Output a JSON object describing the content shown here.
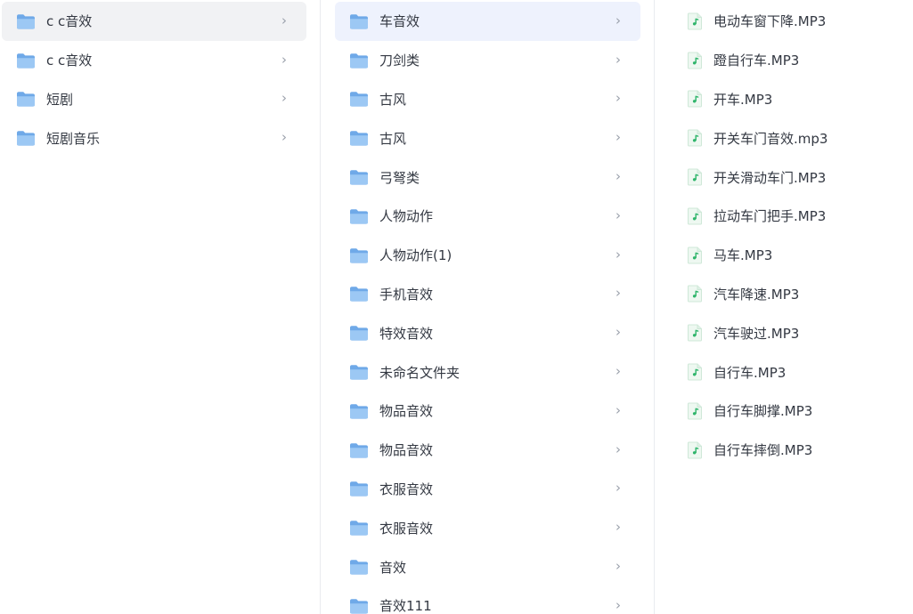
{
  "colors": {
    "folder_light": "#9cc8f4",
    "folder_dark": "#6fa9e8",
    "audio_green": "#2fb56b",
    "selected_col1": "#f1f2f4",
    "selected_col2": "#eef2fd"
  },
  "chevron_glyph": "›",
  "column1": {
    "items": [
      {
        "label": "c c音效",
        "icon": "folder-icon",
        "selected": true
      },
      {
        "label": "c c音效",
        "icon": "folder-icon",
        "selected": false
      },
      {
        "label": "短剧",
        "icon": "folder-icon",
        "selected": false
      },
      {
        "label": "短剧音乐",
        "icon": "folder-icon",
        "selected": false
      }
    ]
  },
  "column2": {
    "items": [
      {
        "label": "车音效",
        "icon": "folder-icon",
        "selected": true
      },
      {
        "label": "刀剑类",
        "icon": "folder-icon",
        "selected": false
      },
      {
        "label": "古风",
        "icon": "folder-icon",
        "selected": false
      },
      {
        "label": "古风",
        "icon": "folder-icon",
        "selected": false
      },
      {
        "label": "弓弩类",
        "icon": "folder-icon",
        "selected": false
      },
      {
        "label": "人物动作",
        "icon": "folder-icon",
        "selected": false
      },
      {
        "label": "人物动作(1)",
        "icon": "folder-icon",
        "selected": false
      },
      {
        "label": "手机音效",
        "icon": "folder-icon",
        "selected": false
      },
      {
        "label": "特效音效",
        "icon": "folder-icon",
        "selected": false
      },
      {
        "label": "未命名文件夹",
        "icon": "folder-icon",
        "selected": false
      },
      {
        "label": "物品音效",
        "icon": "folder-icon",
        "selected": false
      },
      {
        "label": "物品音效",
        "icon": "folder-icon",
        "selected": false
      },
      {
        "label": "衣服音效",
        "icon": "folder-icon",
        "selected": false
      },
      {
        "label": "衣服音效",
        "icon": "folder-icon",
        "selected": false
      },
      {
        "label": "音效",
        "icon": "folder-icon",
        "selected": false
      },
      {
        "label": "音效111",
        "icon": "folder-icon",
        "selected": false
      }
    ]
  },
  "column3": {
    "items": [
      {
        "label": "电动车窗下降.MP3",
        "icon": "audio-file-icon"
      },
      {
        "label": "蹬自行车.MP3",
        "icon": "audio-file-icon"
      },
      {
        "label": "开车.MP3",
        "icon": "audio-file-icon"
      },
      {
        "label": "开关车门音效.mp3",
        "icon": "audio-file-icon"
      },
      {
        "label": "开关滑动车门.MP3",
        "icon": "audio-file-icon"
      },
      {
        "label": "拉动车门把手.MP3",
        "icon": "audio-file-icon"
      },
      {
        "label": "马车.MP3",
        "icon": "audio-file-icon"
      },
      {
        "label": "汽车降速.MP3",
        "icon": "audio-file-icon"
      },
      {
        "label": "汽车驶过.MP3",
        "icon": "audio-file-icon"
      },
      {
        "label": "自行车.MP3",
        "icon": "audio-file-icon"
      },
      {
        "label": "自行车脚撑.MP3",
        "icon": "audio-file-icon"
      },
      {
        "label": "自行车摔倒.MP3",
        "icon": "audio-file-icon"
      }
    ]
  }
}
